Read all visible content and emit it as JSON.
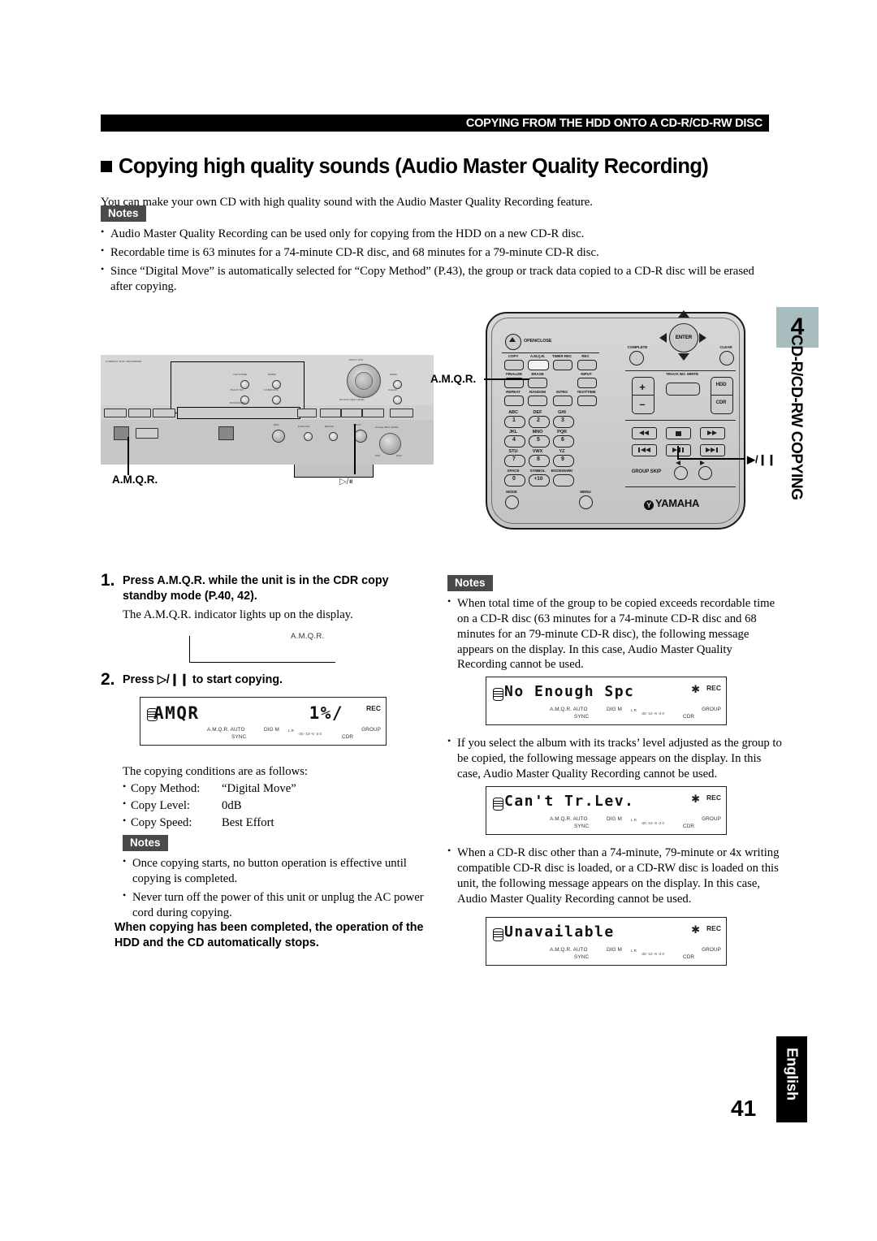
{
  "header": {
    "running_head": "COPYING FROM THE HDD ONTO A CD-R/CD-RW DISC",
    "title": "Copying high quality sounds (Audio Master Quality Recording)"
  },
  "intro": "You can make your own CD with high quality sound with the Audio Master Quality Recording feature.",
  "notes_label": "Notes",
  "notes_top": [
    "Audio Master Quality Recording can be used only for copying from the HDD on a new CD-R disc.",
    "Recordable time is 63 minutes for a 74-minute CD-R disc, and 68 minutes for a 79-minute CD-R disc.",
    "Since “Digital Move” is automatically selected for “Copy Method” (P.43), the group or track data copied to a CD-R disc will be erased after copying."
  ],
  "sidebar": {
    "chapter_number": "4",
    "chapter_title": "CD-R/CD-RW COPYING",
    "language_tab": "English",
    "page_number": "41"
  },
  "figure": {
    "unit_callout_amqr": "A.M.Q.R.",
    "unit_callout_playpause": "▷/⏸",
    "remote_callout_amqr": "A.M.Q.R.",
    "remote_callout_playpause": "▶/❙❙",
    "unit_brand": "COMPACT DISC RECORDER",
    "remote_brand": "YAMAHA",
    "remote_buttons": {
      "open_close": "OPEN/CLOSE",
      "row1": [
        "COPY",
        "A.M.Q.R.",
        "TIMER REC",
        "REC"
      ],
      "row2": [
        "FINALIZE",
        "ERASE",
        "INPUT"
      ],
      "row3": [
        "REPEAT",
        "RANDOM",
        "INTRO",
        "TEXT/TIME"
      ],
      "keypad": [
        {
          "letters": "ABC",
          "digit": "1"
        },
        {
          "letters": "DEF",
          "digit": "2"
        },
        {
          "letters": "GHI",
          "digit": "3"
        },
        {
          "letters": "JKL",
          "digit": "4"
        },
        {
          "letters": "MNO",
          "digit": "5"
        },
        {
          "letters": "PQR",
          "digit": "6"
        },
        {
          "letters": "STU",
          "digit": "7"
        },
        {
          "letters": "VWX",
          "digit": "8"
        },
        {
          "letters": "YZ",
          "digit": "9"
        },
        {
          "letters": "SPACE",
          "digit": "0"
        },
        {
          "letters": "SYMBOL",
          "digit": "+10"
        },
        {
          "letters": "BOOKMARK",
          "digit": ""
        }
      ],
      "mode": "MODE",
      "menu": "MENU",
      "enter": "ENTER",
      "complete": "COMPLETE",
      "clear": "CLEAR",
      "track_no_write": "TRACK NO. WRITE",
      "hdd": "HDD",
      "cdr": "CDR",
      "group_skip": "GROUP SKIP",
      "plus": "+",
      "minus": "–"
    },
    "unit_labels": {
      "text_time": "TEXT/TIME",
      "mode": "MODE",
      "menu": "MENU",
      "track_no": "TRACK NO.",
      "complete": "COMPLETE",
      "bookmark": "BOOKMARK",
      "enter": "ENTER",
      "clear": "CLEAR",
      "jog_outer": "MULTI JOG",
      "digital_rec_level": "DIGITAL REC LEVEL",
      "rec": "REC",
      "finalize": "FINALIZE",
      "erase": "ERASE",
      "input": "INPUT",
      "analog_rec_level": "Analog REC LEVEL",
      "min": "MIN",
      "max": "MAX",
      "copy": "COPY",
      "hdd": "HDD",
      "cdr": "CDR"
    }
  },
  "steps": [
    {
      "num": "1.",
      "text": "Press A.M.Q.R. while the unit is in the CDR copy standby mode (P.40, 42).",
      "sub": "The A.M.Q.R. indicator lights up on the display.",
      "callout": "A.M.Q.R."
    },
    {
      "num": "2.",
      "text": "Press ▷/❙❙ to start copying."
    }
  ],
  "conditions": {
    "lead": "The copying conditions are as follows:",
    "rows": [
      {
        "key": "Copy Method:",
        "value": "“Digital Move”"
      },
      {
        "key": "Copy Level:",
        "value": "0dB"
      },
      {
        "key": "Copy Speed:",
        "value": "Best Effort"
      }
    ]
  },
  "notes_left_bottom": [
    "Once copying starts, no button operation is effective until copying is completed.",
    "Never turn off the power of this unit or unplug the AC power cord during copying."
  ],
  "bold_note_left": "When copying has been completed, the operation of the HDD and the CD automatically stops.",
  "notes_right": [
    "When total time of the group to be copied exceeds recordable time on a CD-R disc (63 minutes for a 74-minute CD-R disc and 68 minutes for an 79-minute CD-R disc), the following message appears on the display. In this case, Audio Master Quality Recording cannot be used.",
    "If you select the album with its tracks’ level adjusted as the group to be copied, the following message appears on the display. In this case, Audio Master Quality Recording cannot be used.",
    "When a CD-R disc other than a 74-minute, 79-minute or 4x writing compatible CD-R disc is loaded, or a CD-RW disc is loaded on this unit, the following message appears on the display. In this case, Audio Master Quality Recording cannot be used."
  ],
  "displays": {
    "amqr": {
      "main": "AMQR",
      "right": "1%/",
      "rec": "REC",
      "indicators_top": "A.M.Q.R. AUTO",
      "indicators_sync": "SYNC",
      "indicators_digm": "DIG M",
      "indicators_lr": "L R",
      "scale": "-30 -10 -6 -2 0",
      "indicators_cdr": "CDR",
      "indicators_group": "GROUP"
    },
    "no_enough": {
      "main": "No Enough Spc",
      "rec": "REC",
      "indicators_top": "A.M.Q.R. AUTO",
      "indicators_sync": "SYNC",
      "indicators_digm": "DIG M",
      "indicators_lr": "L R",
      "scale": "-30 -10 -6 -2 0",
      "indicators_cdr": "CDR",
      "indicators_group": "GROUP"
    },
    "cant_tr_lev": {
      "main": "Can't Tr.Lev.",
      "rec": "REC",
      "indicators_top": "A.M.Q.R. AUTO",
      "indicators_sync": "SYNC",
      "indicators_digm": "DIG M",
      "indicators_lr": "L R",
      "scale": "-30 -10 -6 -2 0",
      "indicators_cdr": "CDR",
      "indicators_group": "GROUP"
    },
    "unavailable": {
      "main": "Unavailable",
      "rec": "REC",
      "indicators_top": "A.M.Q.R. AUTO",
      "indicators_sync": "SYNC",
      "indicators_digm": "DIG M",
      "indicators_lr": "L R",
      "scale": "-30 -10 -6 -2 0",
      "indicators_cdr": "CDR",
      "indicators_group": "GROUP"
    }
  },
  "colors": {
    "chapter_tab": "#a8bdbd",
    "notes_chip": "#4a4a4a",
    "header_bar": "#000000"
  }
}
